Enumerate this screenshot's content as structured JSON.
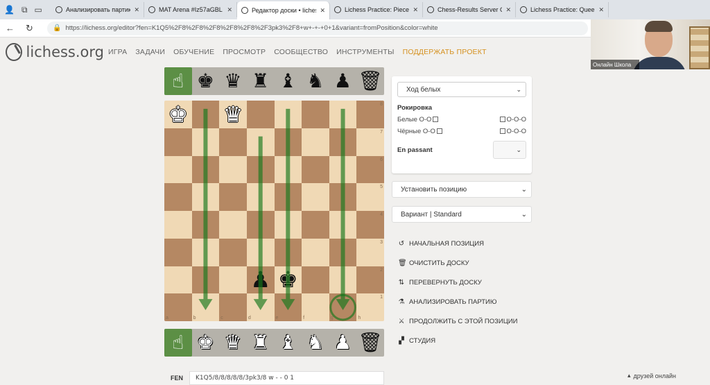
{
  "browser": {
    "tabs": [
      {
        "title": "Анализировать партию -",
        "active": false
      },
      {
        "title": "MAT Arena #Iz57aGBL •",
        "active": false
      },
      {
        "title": "Редактор доски • lichess.o",
        "active": true
      },
      {
        "title": "Lichess Practice: Piece Ch",
        "active": false
      },
      {
        "title": "Chess-Results Server Che",
        "active": false
      },
      {
        "title": "Lichess Practice: Queen",
        "active": false
      }
    ],
    "url": "https://lichess.org/editor?fen=K1Q5%2F8%2F8%2F8%2F8%2F8%2F3pk3%2F8+w+-+-+0+1&variant=fromPosition&color=white"
  },
  "site": {
    "logo": "lichess.org",
    "nav": [
      "ИГРА",
      "ЗАДАЧИ",
      "ОБУЧЕНИЕ",
      "ПРОСМОТР",
      "СООБЩЕСТВО",
      "ИНСТРУМЕНТЫ"
    ],
    "donate": "ПОДДЕРЖАТЬ ПРОЕКТ"
  },
  "webcam": {
    "caption": "Онлайн Школа"
  },
  "editor": {
    "spare_top": [
      "hand-icon",
      "black-king",
      "black-queen",
      "black-rook",
      "black-bishop",
      "black-knight",
      "black-pawn",
      "trash-icon"
    ],
    "spare_bottom": [
      "hand-icon",
      "white-king",
      "white-queen",
      "white-rook",
      "white-bishop",
      "white-knight",
      "white-pawn",
      "trash-icon"
    ],
    "ranks": [
      "8",
      "7",
      "6",
      "5",
      "4",
      "3",
      "2",
      "1"
    ],
    "files": [
      "a",
      "b",
      "c",
      "d",
      "e",
      "f",
      "g",
      "h"
    ],
    "pieces": [
      {
        "square": "a8",
        "piece": "white-king"
      },
      {
        "square": "c8",
        "piece": "white-queen"
      },
      {
        "square": "d2",
        "piece": "black-pawn"
      },
      {
        "square": "e2",
        "piece": "black-king"
      }
    ],
    "arrows": [
      {
        "from": "b8",
        "to": "b1"
      },
      {
        "from": "d7",
        "to": "d1"
      },
      {
        "from": "e8",
        "to": "e1"
      },
      {
        "from": "g8",
        "to": "g1"
      }
    ],
    "circle": "g1",
    "arrow_color": "#15781b",
    "fen_label": "FEN",
    "fen": "K1Q5/8/8/8/8/8/3pk3/8 w - - 0 1"
  },
  "panel": {
    "turn": "Ход белых",
    "castling_title": "Рокировка",
    "white_oo": "Белые О-О",
    "white_ooo": "О-О-О",
    "black_oo": "Чёрные О-О",
    "black_ooo": "О-О-О",
    "en_passant": "En passant",
    "setup": "Установить позицию",
    "variant": "Вариант | Standard"
  },
  "actions": [
    {
      "icon": "reset-icon",
      "glyph": "↺",
      "label": "НАЧАЛЬНАЯ ПОЗИЦИЯ"
    },
    {
      "icon": "trash-icon",
      "glyph": "🗑",
      "label": "ОЧИСТИТЬ ДОСКУ"
    },
    {
      "icon": "flip-icon",
      "glyph": "⇅",
      "label": "ПЕРЕВЕРНУТЬ ДОСКУ"
    },
    {
      "icon": "microscope-icon",
      "glyph": "⚗",
      "label": "АНАЛИЗИРОВАТЬ ПАРТИЮ"
    },
    {
      "icon": "swords-icon",
      "glyph": "⚔",
      "label": "ПРОДОЛЖИТЬ С ЭТОЙ ПОЗИЦИИ"
    },
    {
      "icon": "study-icon",
      "glyph": "▞",
      "label": "СТУДИЯ"
    }
  ],
  "status": {
    "friends": "друзей онлайн"
  }
}
